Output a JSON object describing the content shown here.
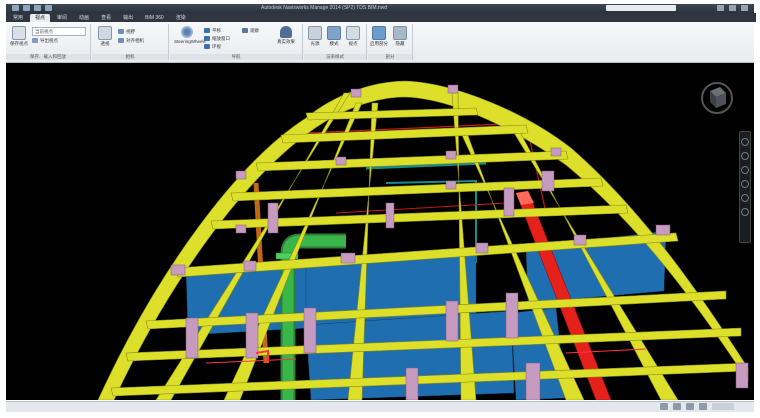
{
  "window": {
    "title": "Autodesk Navisworks Manage 2014 (SP2)   TDS BIM.nwd"
  },
  "ribbon": {
    "tabs": [
      "常用",
      "视点",
      "审阅",
      "动画",
      "查看",
      "输出",
      "BIM 360",
      "渲染"
    ],
    "active_tab_index": 1,
    "groups": {
      "save_load": {
        "label": "保存、载入和回放",
        "buttons": [
          "保存视点",
          "导出视点"
        ],
        "combo_placeholder": "当前视点"
      },
      "camera": {
        "label": "相机",
        "buttons": [
          "透视",
          "视野",
          "对齐相机"
        ]
      },
      "navigate": {
        "label": "导航",
        "buttons": [
          "SteeringWheels",
          "平移",
          "缩放窗口",
          "环视",
          "观察",
          "真实效果"
        ]
      },
      "render_style": {
        "label": "渲染样式",
        "buttons": [
          "光源",
          "模式",
          "视点"
        ]
      },
      "sectioning": {
        "label": "剖分",
        "buttons": [
          "启用剖分",
          "隐藏"
        ]
      }
    }
  },
  "viewport": {
    "background": "#000000",
    "colors": {
      "beams": "#dde02a",
      "columns": "#c79ac0",
      "walls": "#1f6fb0",
      "pipe_green": "#39b54a",
      "pipe_red": "#e6211b",
      "pipe_orange": "#e57b1c",
      "ducts_cyan": "#1aa6a6"
    },
    "icons": [
      "viewcube-icon",
      "navigation-bar"
    ]
  },
  "statusbar": {
    "icons": [
      "status-icon",
      "status-icon",
      "status-icon",
      "status-icon",
      "pager-icon"
    ]
  }
}
